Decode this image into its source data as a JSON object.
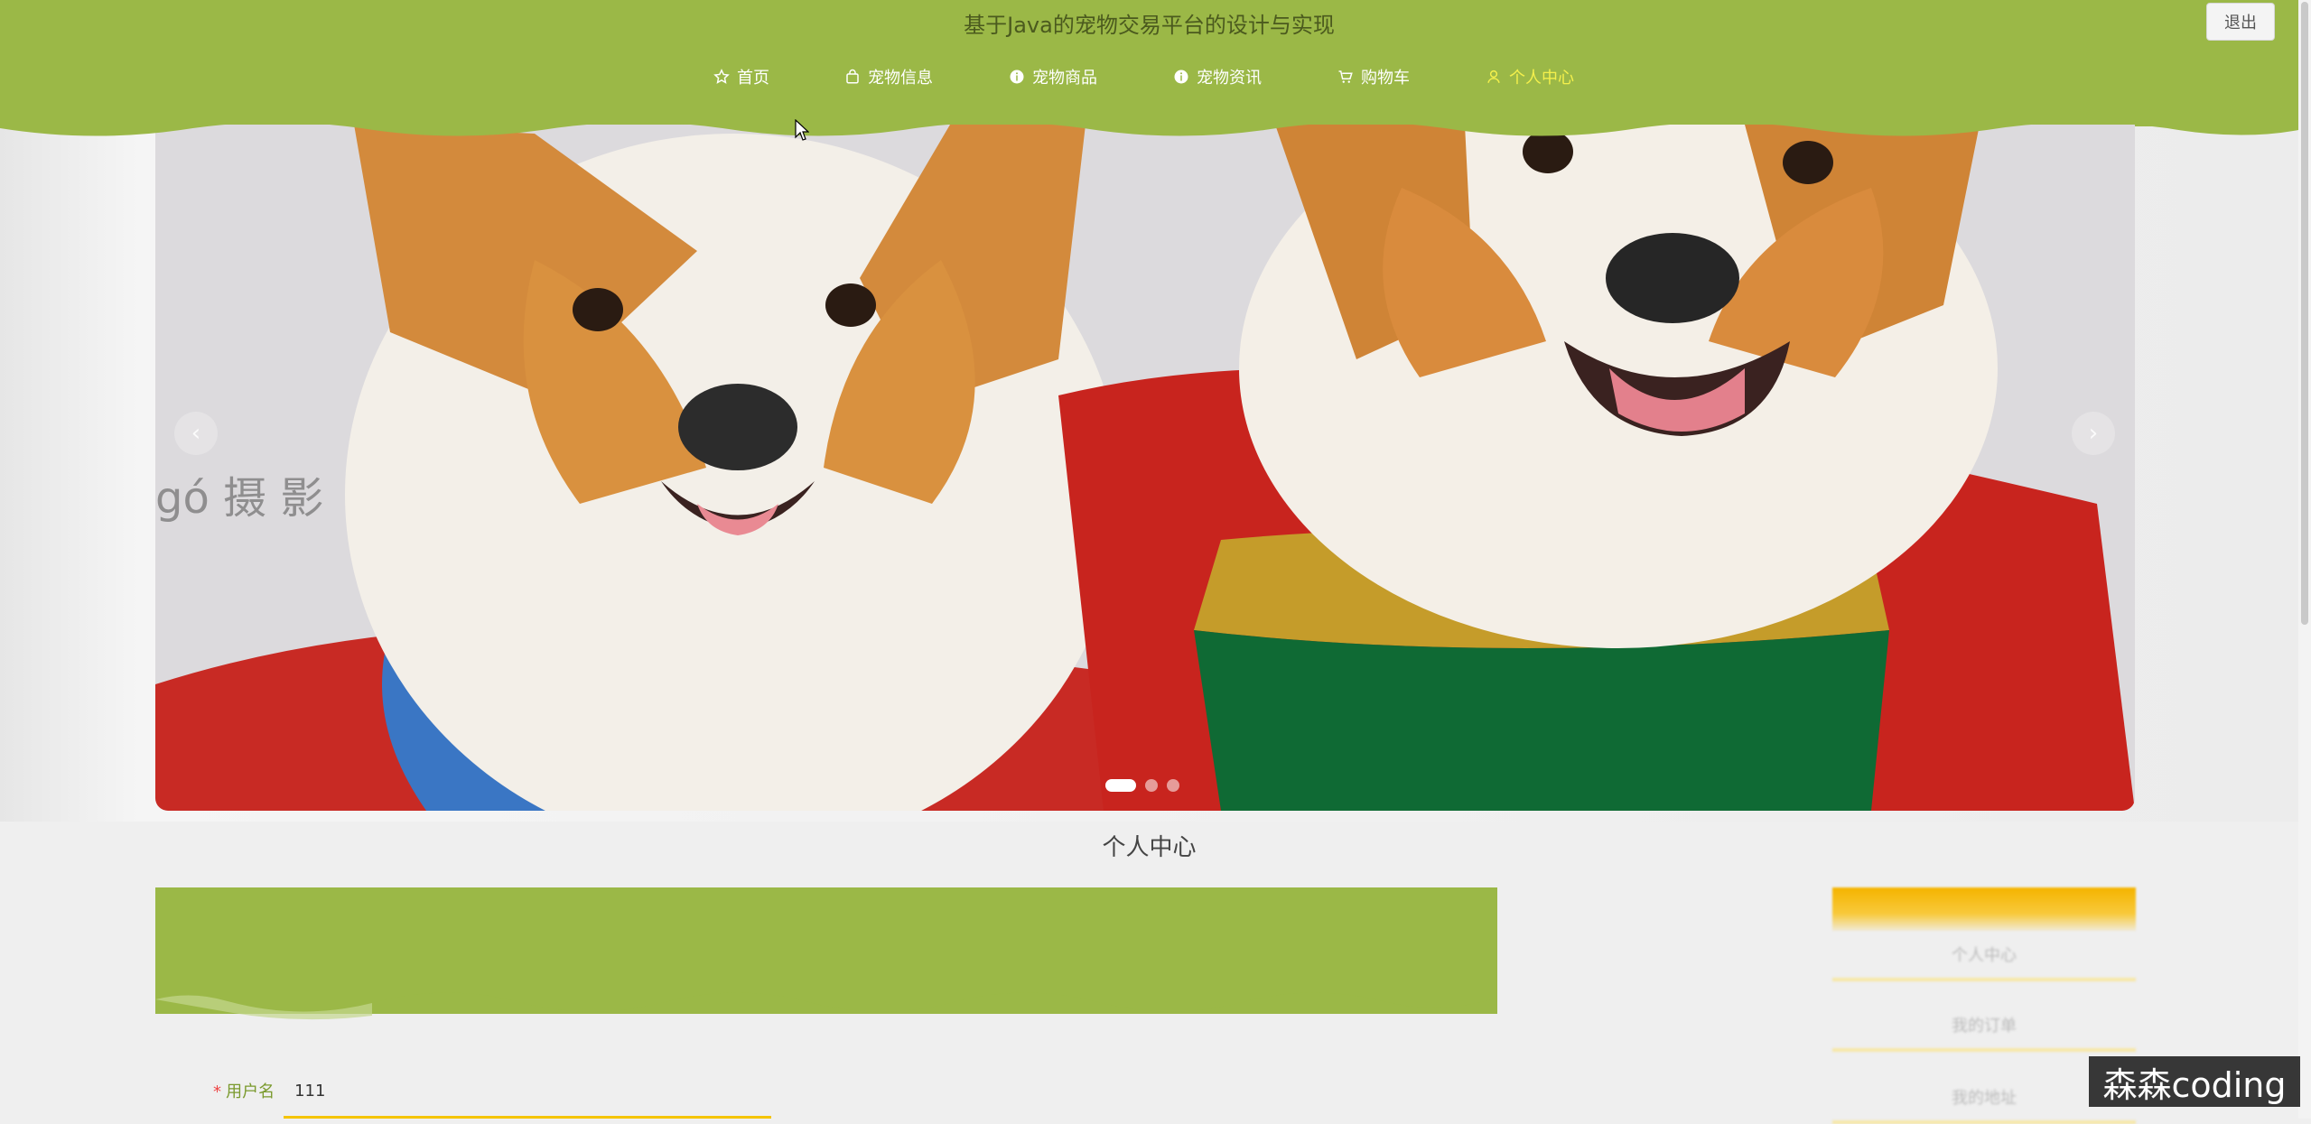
{
  "header": {
    "title": "基于Java的宠物交易平台的设计与实现",
    "logout_label": "退出"
  },
  "nav": {
    "items": [
      {
        "label": "首页",
        "icon": "star-icon"
      },
      {
        "label": "宠物信息",
        "icon": "bag-icon"
      },
      {
        "label": "宠物商品",
        "icon": "info-icon"
      },
      {
        "label": "宠物资讯",
        "icon": "info-icon"
      },
      {
        "label": "购物车",
        "icon": "cart-icon"
      },
      {
        "label": "个人中心",
        "icon": "user-icon",
        "active": true
      }
    ]
  },
  "carousel": {
    "watermark_text": "gó 摄 影",
    "slide_count": 3,
    "active_slide": 1
  },
  "section": {
    "title": "个人中心"
  },
  "profile_form": {
    "username_label": "用户名",
    "username_value": "111"
  },
  "side_menu": {
    "items": [
      "个人中心",
      "我的订单",
      "我的地址"
    ]
  },
  "overlay": {
    "watermark": "森森coding"
  },
  "colors": {
    "header_green": "#9bb847",
    "active_nav": "#f4f04c",
    "accent_yellow": "#f5c400"
  }
}
